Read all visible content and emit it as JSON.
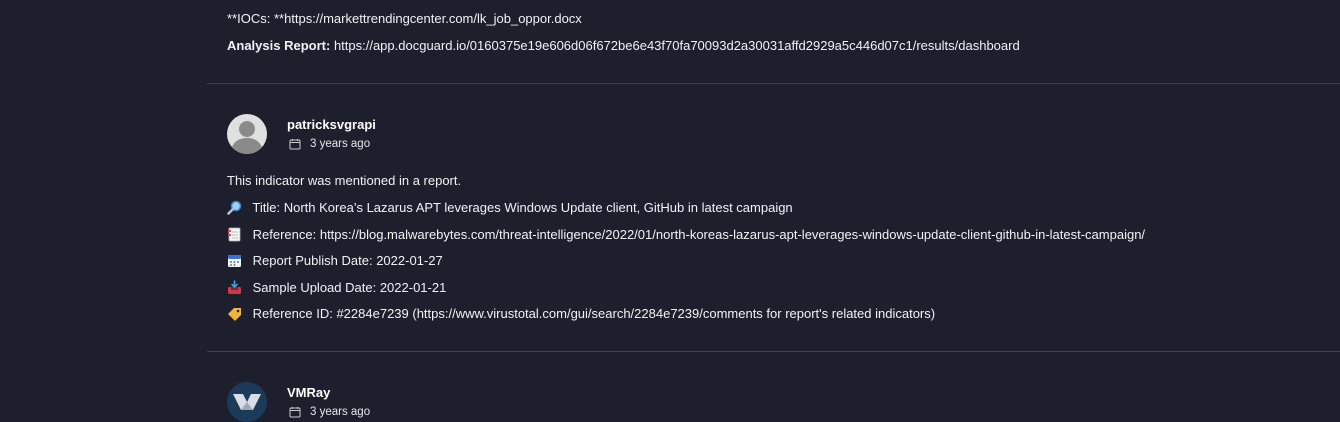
{
  "prev_comment": {
    "iocs_label": "**IOCs: **",
    "iocs_value": "https://markettrendingcenter.com/lk_job_oppor.docx",
    "report_label": "Analysis Report:",
    "report_value": "https://app.docguard.io/0160375e19e606d06f672be6e43f70fa70093d2a30031affd2929a5c446d07c1/results/dashboard"
  },
  "comment1": {
    "author": "patricksvgrapi",
    "time": "3 years ago",
    "avatar_icon": "default-user-avatar",
    "intro": "This indicator was mentioned in a report.",
    "title_icon": "magnifying-glass-icon",
    "title_label": "Title:",
    "title_value": "North Korea’s Lazarus APT leverages Windows Update client, GitHub in latest campaign",
    "reference_icon": "bookmark-tabs-icon",
    "reference_label": "Reference:",
    "reference_value": "https://blog.malwarebytes.com/threat-intelligence/2022/01/north-koreas-lazarus-apt-leverages-windows-update-client-github-in-latest-campaign/",
    "publish_icon": "calendar-icon",
    "publish_label": "Report Publish Date:",
    "publish_value": "2022-01-27",
    "upload_icon": "inbox-tray-icon",
    "upload_label": "Sample Upload Date:",
    "upload_value": "2022-01-21",
    "refid_icon": "label-tag-icon",
    "refid_label": "Reference ID:",
    "refid_value": "#2284e7239 (https://www.virustotal.com/gui/search/2284e7239/comments for report's related indicators)"
  },
  "comment2": {
    "author": "VMRay",
    "time": "3 years ago",
    "avatar_icon": "vmray-logo"
  },
  "colors": {
    "background": "#1e1f2c",
    "divider": "#3d4052",
    "text": "#f2f2f5"
  }
}
